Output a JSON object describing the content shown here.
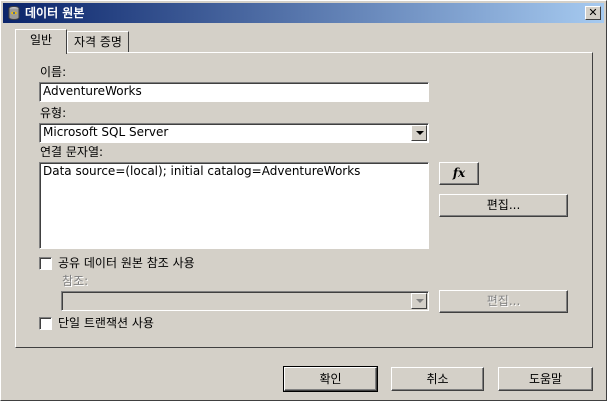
{
  "window": {
    "title": "데이터 원본",
    "close_glyph": "✕"
  },
  "tabs": [
    {
      "label": "일반",
      "active": true
    },
    {
      "label": "자격 증명",
      "active": false
    }
  ],
  "general": {
    "name_label": "이름:",
    "name_value": "AdventureWorks",
    "type_label": "유형:",
    "type_value": "Microsoft SQL Server",
    "conn_label": "연결 문자열:",
    "conn_value": "Data source=(local); initial catalog=AdventureWorks",
    "fx_label": "fx",
    "edit_label": "편집...",
    "shared_label": "공유 데이터 원본 참조 사용",
    "shared_checked": false,
    "ref_label": "참조:",
    "ref_value": "",
    "ref_edit_label": "편집...",
    "single_tx_label": "단일 트랜잭션 사용",
    "single_tx_checked": false
  },
  "footer": {
    "ok": "확인",
    "cancel": "취소",
    "help": "도움말"
  },
  "colors": {
    "face": "#d4d0c8",
    "title_start": "#0a246a",
    "title_end": "#a6caf0"
  },
  "icons": {
    "title": "data-source-icon",
    "close": "close-icon",
    "dropdown": "chevron-down-icon"
  }
}
